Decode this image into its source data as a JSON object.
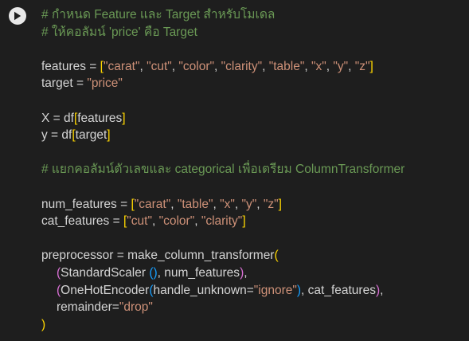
{
  "cell": {
    "run_button": "run-cell-button",
    "lines": [
      {
        "t": [
          {
            "c": "cm",
            "v": "# กำหนด Feature และ Target สำหรับโมเดล"
          }
        ]
      },
      {
        "t": [
          {
            "c": "cm",
            "v": "# ให้คอลัมน์ 'price' คือ Target"
          }
        ]
      },
      {
        "t": []
      },
      {
        "t": [
          {
            "c": "",
            "v": "features = "
          },
          {
            "c": "br",
            "v": "["
          },
          {
            "c": "st",
            "v": "\"carat\""
          },
          {
            "c": "",
            "v": ", "
          },
          {
            "c": "st",
            "v": "\"cut\""
          },
          {
            "c": "",
            "v": ", "
          },
          {
            "c": "st",
            "v": "\"color\""
          },
          {
            "c": "",
            "v": ", "
          },
          {
            "c": "st",
            "v": "\"clarity\""
          },
          {
            "c": "",
            "v": ", "
          },
          {
            "c": "st",
            "v": "\"table\""
          },
          {
            "c": "",
            "v": ", "
          },
          {
            "c": "st",
            "v": "\"x\""
          },
          {
            "c": "",
            "v": ", "
          },
          {
            "c": "st",
            "v": "\"y\""
          },
          {
            "c": "",
            "v": ", "
          },
          {
            "c": "st",
            "v": "\"z\""
          },
          {
            "c": "br",
            "v": "]"
          }
        ]
      },
      {
        "t": [
          {
            "c": "",
            "v": "target = "
          },
          {
            "c": "st",
            "v": "\"price\""
          }
        ]
      },
      {
        "t": []
      },
      {
        "t": [
          {
            "c": "",
            "v": "X = df"
          },
          {
            "c": "br",
            "v": "["
          },
          {
            "c": "",
            "v": "features"
          },
          {
            "c": "br",
            "v": "]"
          }
        ]
      },
      {
        "t": [
          {
            "c": "",
            "v": "y = df"
          },
          {
            "c": "br",
            "v": "["
          },
          {
            "c": "",
            "v": "target"
          },
          {
            "c": "br",
            "v": "]"
          }
        ]
      },
      {
        "t": []
      },
      {
        "t": [
          {
            "c": "cm",
            "v": "# แยกคอลัมน์ตัวเลขและ categorical เพื่อเตรียม ColumnTransformer"
          }
        ]
      },
      {
        "t": []
      },
      {
        "t": [
          {
            "c": "",
            "v": "num_features = "
          },
          {
            "c": "br",
            "v": "["
          },
          {
            "c": "st",
            "v": "\"carat\""
          },
          {
            "c": "",
            "v": ", "
          },
          {
            "c": "st",
            "v": "\"table\""
          },
          {
            "c": "",
            "v": ", "
          },
          {
            "c": "st",
            "v": "\"x\""
          },
          {
            "c": "",
            "v": ", "
          },
          {
            "c": "st",
            "v": "\"y\""
          },
          {
            "c": "",
            "v": ", "
          },
          {
            "c": "st",
            "v": "\"z\""
          },
          {
            "c": "br",
            "v": "]"
          }
        ]
      },
      {
        "t": [
          {
            "c": "",
            "v": "cat_features = "
          },
          {
            "c": "br",
            "v": "["
          },
          {
            "c": "st",
            "v": "\"cut\""
          },
          {
            "c": "",
            "v": ", "
          },
          {
            "c": "st",
            "v": "\"color\""
          },
          {
            "c": "",
            "v": ", "
          },
          {
            "c": "st",
            "v": "\"clarity\""
          },
          {
            "c": "br",
            "v": "]"
          }
        ]
      },
      {
        "t": []
      },
      {
        "t": [
          {
            "c": "",
            "v": "preprocessor = make_column_transformer"
          },
          {
            "c": "br",
            "v": "("
          }
        ]
      },
      {
        "i": true,
        "t": [
          {
            "c": "bp",
            "v": "("
          },
          {
            "c": "",
            "v": "StandardScaler "
          },
          {
            "c": "bb",
            "v": "()"
          },
          {
            "c": "",
            "v": ", num_features"
          },
          {
            "c": "bp",
            "v": ")"
          },
          {
            "c": "",
            "v": ","
          }
        ]
      },
      {
        "i": true,
        "t": [
          {
            "c": "bp",
            "v": "("
          },
          {
            "c": "",
            "v": "OneHotEncoder"
          },
          {
            "c": "bb",
            "v": "("
          },
          {
            "c": "",
            "v": "handle_unknown="
          },
          {
            "c": "st",
            "v": "\"ignore\""
          },
          {
            "c": "bb",
            "v": ")"
          },
          {
            "c": "",
            "v": ", cat_features"
          },
          {
            "c": "bp",
            "v": ")"
          },
          {
            "c": "",
            "v": ","
          }
        ]
      },
      {
        "i": true,
        "t": [
          {
            "c": "",
            "v": "remainder="
          },
          {
            "c": "st",
            "v": "\"drop\""
          }
        ]
      },
      {
        "t": [
          {
            "c": "br",
            "v": ")"
          }
        ]
      }
    ]
  }
}
